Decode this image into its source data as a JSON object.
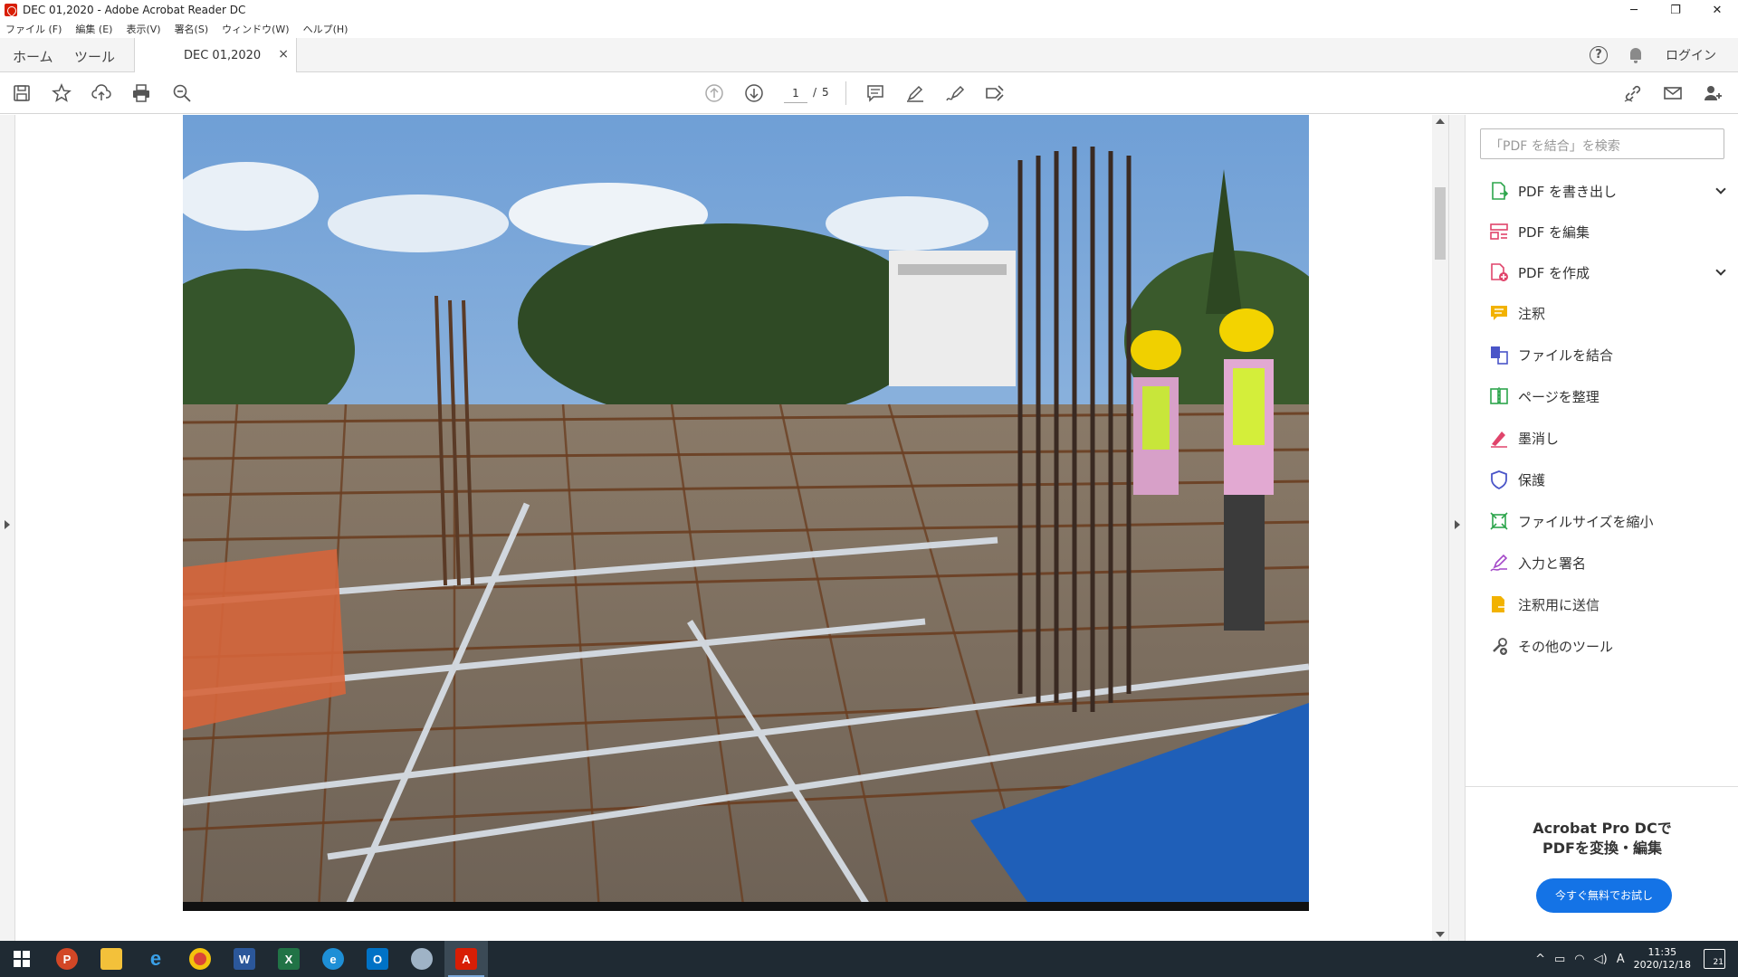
{
  "window": {
    "title": "DEC 01,2020 - Adobe Acrobat Reader DC",
    "controls": [
      "─",
      "❐",
      "✕"
    ]
  },
  "menu": [
    "ファイル (F)",
    "編集 (E)",
    "表示(V)",
    "署名(S)",
    "ウィンドウ(W)",
    "ヘルプ(H)"
  ],
  "tabs": {
    "home": "ホーム",
    "tools": "ツール",
    "document": "DEC 01,2020",
    "close": "×",
    "help": "?",
    "login": "ログイン"
  },
  "toolbar": {
    "page_current": "1",
    "page_separator": "/",
    "page_total": "5"
  },
  "panel": {
    "search_placeholder": "「PDF を結合」を検索",
    "tools": [
      {
        "label": "PDF を書き出し",
        "color": "#2da54c",
        "icon": "export-pdf-icon"
      },
      {
        "label": "PDF を編集",
        "color": "#e0446b",
        "icon": "edit-pdf-icon"
      },
      {
        "label": "PDF を作成",
        "color": "#e0446b",
        "icon": "create-pdf-icon"
      },
      {
        "label": "注釈",
        "color": "#f2b200",
        "icon": "comment-icon"
      },
      {
        "label": "ファイルを結合",
        "color": "#4a55c8",
        "icon": "combine-files-icon"
      },
      {
        "label": "ページを整理",
        "color": "#2da54c",
        "icon": "organize-pages-icon"
      },
      {
        "label": "墨消し",
        "color": "#e0446b",
        "icon": "redact-icon"
      },
      {
        "label": "保護",
        "color": "#4a55c8",
        "icon": "protect-icon"
      },
      {
        "label": "ファイルサイズを縮小",
        "color": "#2da54c",
        "icon": "compress-icon"
      },
      {
        "label": "入力と署名",
        "color": "#a347c8",
        "icon": "fill-sign-icon"
      },
      {
        "label": "注釈用に送信",
        "color": "#f2b200",
        "icon": "send-comments-icon"
      },
      {
        "label": "その他のツール",
        "color": "#555555",
        "icon": "more-tools-icon"
      }
    ],
    "promo_line1": "Acrobat Pro DCで",
    "promo_line2": "PDFを変換・編集",
    "promo_button": "今すぐ無料でお試し"
  },
  "taskbar": {
    "apps": [
      "start",
      "powerpoint",
      "file-explorer",
      "internet-explorer",
      "chrome",
      "word",
      "excel",
      "edge",
      "outlook",
      "paint",
      "acrobat"
    ],
    "tray_ime": "A",
    "time": "11:35",
    "date": "2020/12/18",
    "notification_count": "21"
  },
  "colors": {
    "accent": "#1473e6",
    "taskbar": "#1f2a33",
    "acrobat_red": "#d81e05"
  }
}
